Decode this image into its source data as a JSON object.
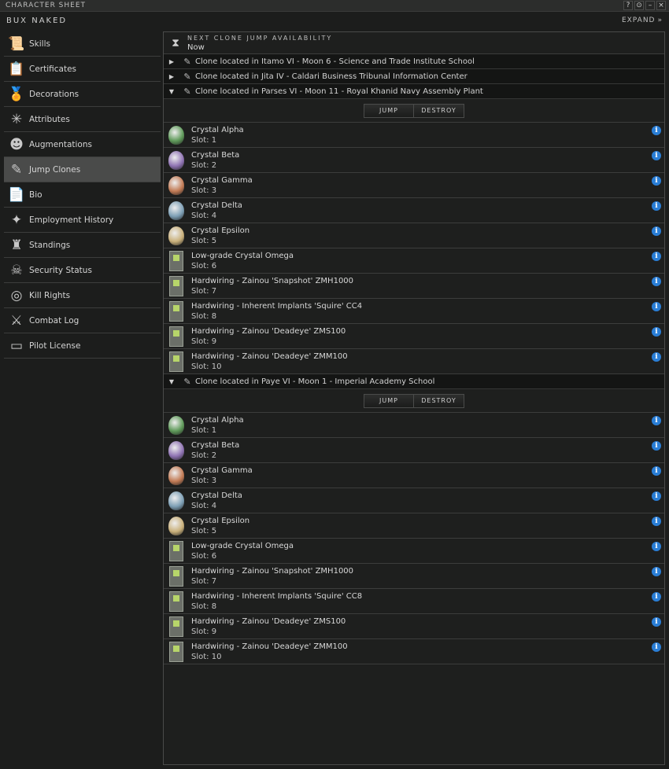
{
  "window": {
    "title": "CHARACTER SHEET",
    "buttons": [
      "?",
      "⊙",
      "–",
      "×"
    ],
    "character": "BUX NAKED",
    "expand_label": "EXPAND"
  },
  "sidebar": {
    "items": [
      {
        "label": "Skills",
        "icon": "skills-icon",
        "glyph": "📜",
        "active": false
      },
      {
        "label": "Certificates",
        "icon": "certificates-icon",
        "glyph": "📋",
        "active": false
      },
      {
        "label": "Decorations",
        "icon": "decorations-icon",
        "glyph": "🏅",
        "active": false
      },
      {
        "label": "Attributes",
        "icon": "attributes-icon",
        "glyph": "✳",
        "active": false
      },
      {
        "label": "Augmentations",
        "icon": "augmentations-icon",
        "glyph": "☻",
        "active": false
      },
      {
        "label": "Jump Clones",
        "icon": "jump-clones-icon",
        "glyph": "✎",
        "active": true
      },
      {
        "label": "Bio",
        "icon": "bio-icon",
        "glyph": "📄",
        "active": false
      },
      {
        "label": "Employment History",
        "icon": "employment-history-icon",
        "glyph": "✦",
        "active": false
      },
      {
        "label": "Standings",
        "icon": "standings-icon",
        "glyph": "♜",
        "active": false
      },
      {
        "label": "Security Status",
        "icon": "security-status-icon",
        "glyph": "☠",
        "active": false
      },
      {
        "label": "Kill Rights",
        "icon": "kill-rights-icon",
        "glyph": "◎",
        "active": false
      },
      {
        "label": "Combat Log",
        "icon": "combat-log-icon",
        "glyph": "⚔",
        "active": false
      },
      {
        "label": "Pilot License",
        "icon": "pilot-license-icon",
        "glyph": "▭",
        "active": false
      }
    ]
  },
  "next_jump": {
    "title": "NEXT CLONE JUMP AVAILABILITY",
    "value": "Now"
  },
  "buttons": {
    "jump": "JUMP",
    "destroy": "DESTROY"
  },
  "clones_collapsed": [
    {
      "label": "Clone located in Itamo VI - Moon 6 - Science and Trade Institute School"
    },
    {
      "label": "Clone located in Jita IV - Caldari Business Tribunal Information Center"
    }
  ],
  "clones_expanded": [
    {
      "label": "Clone located in Parses VI - Moon 11 - Royal Khanid Navy Assembly Plant",
      "implants": [
        {
          "name": "Crystal Alpha",
          "slot": "Slot: 1",
          "kind": "head",
          "color": "#5f9a5a"
        },
        {
          "name": "Crystal Beta",
          "slot": "Slot: 2",
          "kind": "head",
          "color": "#8f73b3"
        },
        {
          "name": "Crystal Gamma",
          "slot": "Slot: 3",
          "kind": "head",
          "color": "#c27b55"
        },
        {
          "name": "Crystal Delta",
          "slot": "Slot: 4",
          "kind": "head",
          "color": "#7d9fb5"
        },
        {
          "name": "Crystal Epsilon",
          "slot": "Slot: 5",
          "kind": "head",
          "color": "#c9b07a"
        },
        {
          "name": "Low-grade Crystal Omega",
          "slot": "Slot: 6",
          "kind": "chip",
          "color": "#b7d56a"
        },
        {
          "name": "Hardwiring - Zainou 'Snapshot' ZMH1000",
          "slot": "Slot: 7",
          "kind": "chip",
          "color": "#b7d56a"
        },
        {
          "name": "Hardwiring - Inherent Implants 'Squire' CC4",
          "slot": "Slot: 8",
          "kind": "chip",
          "color": "#b7d56a"
        },
        {
          "name": "Hardwiring - Zainou 'Deadeye' ZMS100",
          "slot": "Slot: 9",
          "kind": "chip",
          "color": "#b7d56a"
        },
        {
          "name": "Hardwiring - Zainou 'Deadeye' ZMM100",
          "slot": "Slot: 10",
          "kind": "chip",
          "color": "#b7d56a"
        }
      ]
    },
    {
      "label": "Clone located in Paye VI - Moon 1 - Imperial Academy School",
      "implants": [
        {
          "name": "Crystal Alpha",
          "slot": "Slot: 1",
          "kind": "head",
          "color": "#5f9a5a"
        },
        {
          "name": "Crystal Beta",
          "slot": "Slot: 2",
          "kind": "head",
          "color": "#8f73b3"
        },
        {
          "name": "Crystal Gamma",
          "slot": "Slot: 3",
          "kind": "head",
          "color": "#c27b55"
        },
        {
          "name": "Crystal Delta",
          "slot": "Slot: 4",
          "kind": "head",
          "color": "#7d9fb5"
        },
        {
          "name": "Crystal Epsilon",
          "slot": "Slot: 5",
          "kind": "head",
          "color": "#c9b07a"
        },
        {
          "name": "Low-grade Crystal Omega",
          "slot": "Slot: 6",
          "kind": "chip",
          "color": "#b7d56a"
        },
        {
          "name": "Hardwiring - Zainou 'Snapshot' ZMH1000",
          "slot": "Slot: 7",
          "kind": "chip",
          "color": "#b7d56a"
        },
        {
          "name": "Hardwiring - Inherent Implants 'Squire' CC8",
          "slot": "Slot: 8",
          "kind": "chip",
          "color": "#b7d56a"
        },
        {
          "name": "Hardwiring - Zainou 'Deadeye' ZMS100",
          "slot": "Slot: 9",
          "kind": "chip",
          "color": "#b7d56a"
        },
        {
          "name": "Hardwiring - Zainou 'Deadeye' ZMM100",
          "slot": "Slot: 10",
          "kind": "chip",
          "color": "#b7d56a"
        }
      ]
    }
  ]
}
